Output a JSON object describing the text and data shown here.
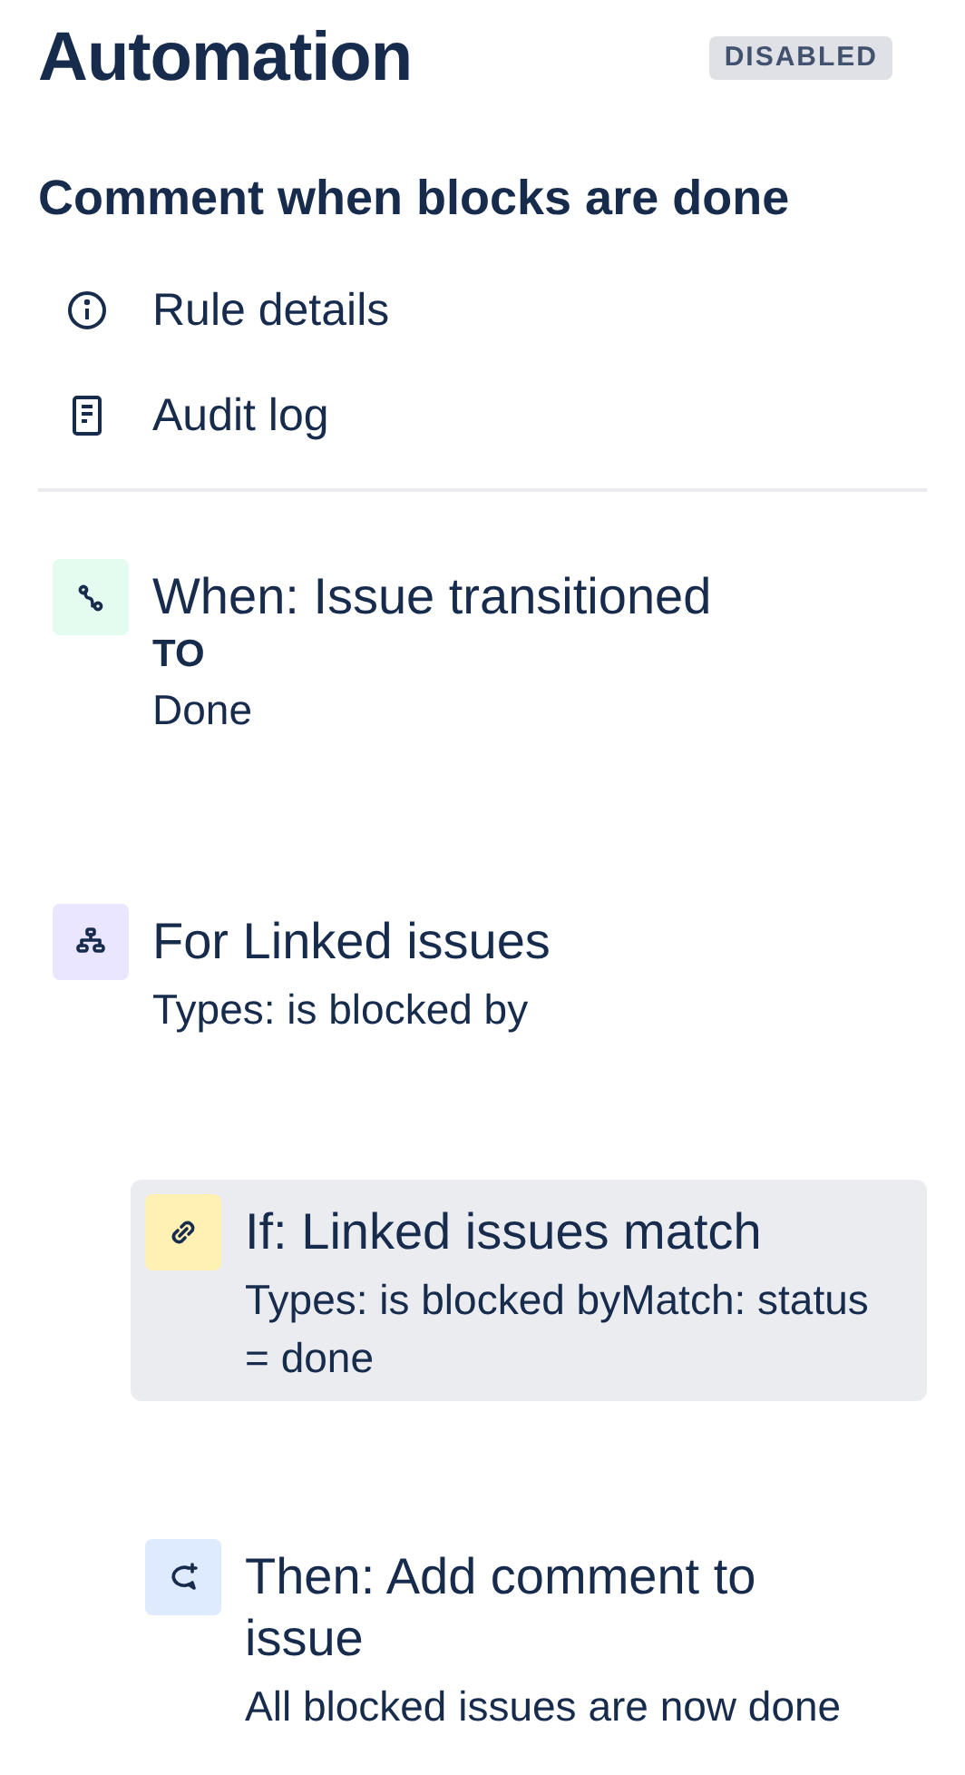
{
  "header": {
    "title": "Automation",
    "badge": "DISABLED"
  },
  "rule": {
    "name": "Comment when blocks are done"
  },
  "menu": [
    {
      "kind": "info",
      "label": "Rule details"
    },
    {
      "kind": "log",
      "label": "Audit log"
    }
  ],
  "steps": [
    {
      "kind": "trigger",
      "title": "When: Issue transitioned",
      "label": "TO",
      "value": "Done",
      "selected": false
    },
    {
      "kind": "branch",
      "title": "For Linked issues",
      "description": "Types: is blocked by",
      "selected": false,
      "children": [
        {
          "kind": "condition",
          "title": "If: Linked issues match",
          "description": "Types: is blocked byMatch: status = done",
          "selected": true
        },
        {
          "kind": "action",
          "title": "Then: Add comment to issue",
          "description": "All blocked issues are now done",
          "selected": false
        }
      ]
    }
  ]
}
